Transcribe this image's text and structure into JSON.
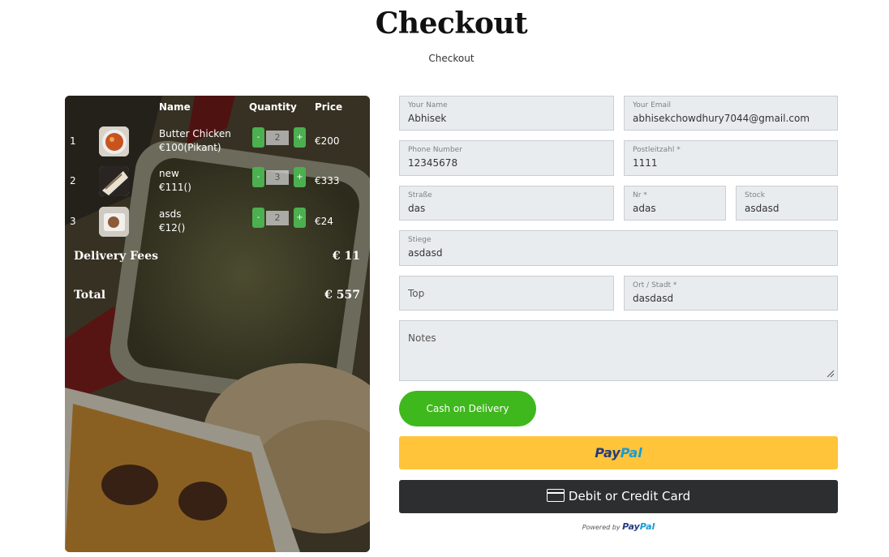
{
  "page": {
    "title": "Checkout",
    "subtitle": "Checkout"
  },
  "cart": {
    "headers": {
      "name": "Name",
      "quantity": "Quantity",
      "price": "Price"
    },
    "items": [
      {
        "index": "1",
        "name": "Butter Chicken",
        "unit_price": "€100(Pikant)",
        "quantity": "2",
        "price": "€200"
      },
      {
        "index": "2",
        "name": "new",
        "unit_price": "€111()",
        "quantity": "3",
        "price": "€333"
      },
      {
        "index": "3",
        "name": "asds",
        "unit_price": "€12()",
        "quantity": "2",
        "price": "€24"
      }
    ],
    "minus_label": "-",
    "plus_label": "+",
    "delivery_fees_label": "Delivery Fees",
    "delivery_fees_value": "€ 11",
    "total_label": "Total",
    "total_value": "€ 557"
  },
  "form": {
    "name": {
      "label": "Your Name",
      "value": "Abhisek"
    },
    "email": {
      "label": "Your Email",
      "value": "abhisekchowdhury7044@gmail.com"
    },
    "phone": {
      "label": "Phone Number",
      "value": "12345678"
    },
    "postcode": {
      "label": "Postleitzahl *",
      "value": "1111"
    },
    "street": {
      "label": "Straße",
      "value": "das"
    },
    "number": {
      "label": "Nr *",
      "value": "adas"
    },
    "floor": {
      "label": "Stock",
      "value": "asdasd"
    },
    "stairs": {
      "label": "Stiege",
      "value": "asdasd"
    },
    "top": {
      "placeholder": "Top"
    },
    "city": {
      "label": "Ort / Stadt *",
      "value": "dasdasd"
    },
    "notes": {
      "placeholder": "Notes"
    }
  },
  "payment": {
    "cash_label": "Cash on Delivery",
    "paypal_part1": "Pay",
    "paypal_part2": "Pal",
    "card_label": "Debit or Credit Card",
    "powered_by": "Powered by",
    "powered_brand_part1": "Pay",
    "powered_brand_part2": "Pal"
  },
  "colors": {
    "cash_button": "#3fb81d",
    "paypal_button": "#ffc439",
    "card_button": "#2c2e2f",
    "quantity_button": "#4caf50"
  }
}
